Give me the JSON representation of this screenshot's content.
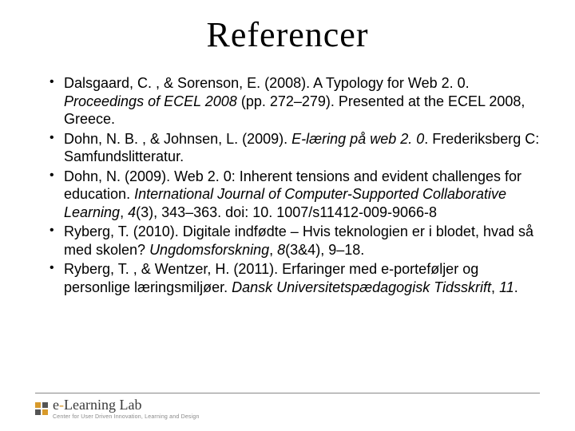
{
  "title": "Referencer",
  "references": [
    {
      "pre": "Dalsgaard, C. , & Sorenson, E. (2008). A Typology for Web 2. 0. ",
      "italic": "Proceedings of ECEL 2008",
      "post": " (pp. 272–279). Presented at the ECEL 2008, Greece."
    },
    {
      "pre": "Dohn, N. B. , & Johnsen, L. (2009). ",
      "italic": "E-læring på web 2. 0",
      "post": ". Frederiksberg C: Samfundslitteratur."
    },
    {
      "pre": "Dohn, N. (2009). Web 2. 0: Inherent tensions and evident challenges for education. ",
      "italic": "International Journal of Computer-Supported Collaborative Learning",
      "mid": ", ",
      "italic2": "4",
      "post": "(3), 343–363. doi: 10. 1007/s11412-009-9066-8"
    },
    {
      "pre": "Ryberg, T. (2010). Digitale indfødte – Hvis teknologien er i blodet, hvad så med skolen? ",
      "italic": "Ungdomsforskning",
      "mid": ", ",
      "italic2": "8",
      "post": "(3&4), 9–18."
    },
    {
      "pre": "Ryberg, T. , & Wentzer, H. (2011). Erfaringer med e-porteføljer og personlige læringsmiljøer. ",
      "italic": "Dansk Universitetspædagogisk Tidsskrift",
      "mid": ", ",
      "italic2": "11",
      "post": "."
    }
  ],
  "logo": {
    "dash": "-",
    "prefix": "e",
    "rest": "Learning Lab",
    "sub": "Center for User Driven Innovation, Learning and Design"
  }
}
